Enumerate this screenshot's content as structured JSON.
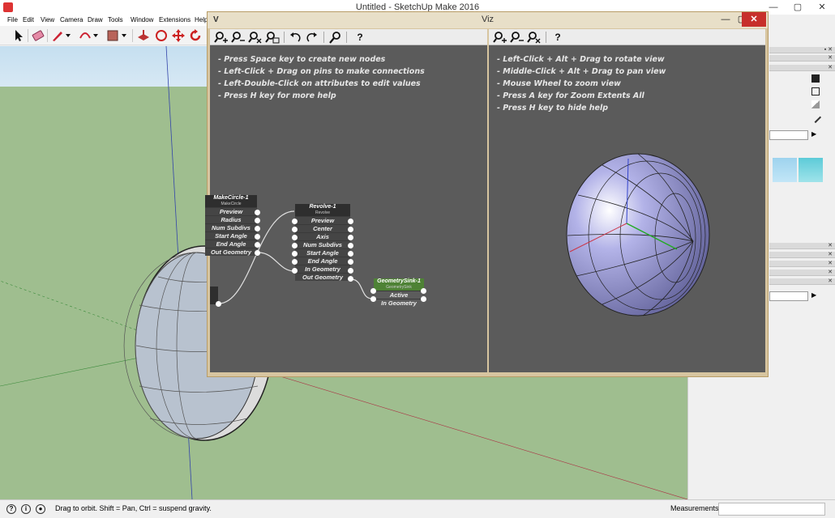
{
  "app": {
    "title": "Untitled - SketchUp Make 2016",
    "menu": [
      "File",
      "Edit",
      "View",
      "Camera",
      "Draw",
      "Tools",
      "Window",
      "Extensions",
      "Help"
    ]
  },
  "viz": {
    "title": "Viz",
    "icon": "V",
    "close_label": "✕",
    "min_label": "—",
    "max_label": "▢",
    "editor_help": [
      "- Press Space key to create new nodes",
      "- Left-Click + Drag on pins to make connections",
      "- Left-Double-Click on attributes to edit values",
      "- Press H key for more help"
    ],
    "viewer_help": [
      "- Left-Click + Alt + Drag to rotate view",
      "- Middle-Click + Alt + Drag to pan view",
      "- Mouse Wheel to zoom view",
      "- Press A key for Zoom Extents All",
      "- Press H key to hide help"
    ],
    "nodes": {
      "makecircle": {
        "name": "MakeCircle-1",
        "type": "MakeCircle",
        "attrs": [
          "Preview",
          "Radius",
          "Num Subdivs",
          "Start Angle",
          "End Angle",
          "Out Geometry"
        ]
      },
      "revolve": {
        "name": "Revolve-1",
        "type": "Revolve",
        "attrs": [
          "Preview",
          "Center",
          "Axis",
          "Num Subdivs",
          "Start Angle",
          "End Angle",
          "In Geometry",
          "Out Geometry"
        ]
      },
      "sink": {
        "name": "GeometrySink-1",
        "type": "GeometrySink",
        "attrs": [
          "Active",
          "In Geometry"
        ]
      }
    }
  },
  "status": {
    "hint": "Drag to orbit. Shift = Pan, Ctrl = suspend gravity.",
    "measurements_label": "Measurements",
    "measurements_value": ""
  },
  "colors": {
    "viz_frame": "#d7c5a0",
    "pane_bg": "#5b5b5b",
    "sink_header": "#4e8235",
    "close_red": "#c7302b",
    "ground": "#9fbe8f"
  }
}
